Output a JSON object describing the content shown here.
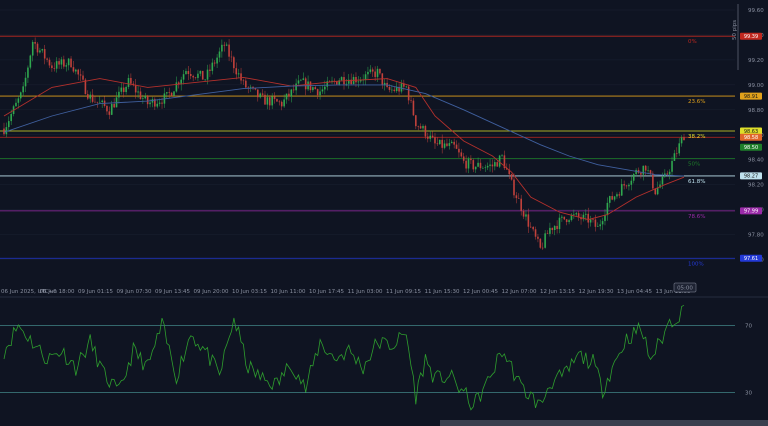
{
  "colors": {
    "background": "#0f1422",
    "grid": "#1b2132",
    "candle_up": "#2fa84f",
    "candle_down": "#c2413b",
    "ma_fast": "#b3302c",
    "ma_slow": "#3f5f9e",
    "rsi_line": "#2e9e2e",
    "rsi_band": "#4a9a9a",
    "axis_text": "#8a90a0",
    "scrollbar": "#3a3f4e"
  },
  "chart_data": [
    {
      "type": "candlestick",
      "name": "price",
      "ylim": [
        97.5,
        99.6
      ],
      "price_ticks": [
        "99.60",
        "99.40",
        "99.20",
        "99.00",
        "98.80",
        "98.60",
        "98.40",
        "98.20",
        "98.00",
        "97.80",
        "97.60"
      ],
      "time_labels": [
        "06 Jun 2025, UTC+0",
        "06 Jun 18:00",
        "09 Jun 01:15",
        "09 Jun 07:30",
        "09 Jun 13:45",
        "09 Jun 20:00",
        "10 Jun 03:15",
        "10 Jun 11:00",
        "10 Jun 17:45",
        "11 Jun 03:00",
        "11 Jun 09:15",
        "11 Jun 15:30",
        "12 Jun 00:45",
        "12 Jun 07:00",
        "12 Jun 13:15",
        "12 Jun 19:30",
        "13 Jun 04:45",
        "13 Jun 11:00"
      ],
      "crosshair_time_tag": "05:00",
      "scale_label": "50 pips",
      "key_points": [
        {
          "t": 0,
          "price": 98.65
        },
        {
          "t": 4,
          "price": 98.95
        },
        {
          "t": 6,
          "price": 99.35
        },
        {
          "t": 10,
          "price": 99.15
        },
        {
          "t": 14,
          "price": 99.18
        },
        {
          "t": 18,
          "price": 98.9
        },
        {
          "t": 22,
          "price": 98.8
        },
        {
          "t": 26,
          "price": 99.02
        },
        {
          "t": 30,
          "price": 98.85
        },
        {
          "t": 34,
          "price": 98.9
        },
        {
          "t": 38,
          "price": 99.12
        },
        {
          "t": 42,
          "price": 99.05
        },
        {
          "t": 46,
          "price": 99.32
        },
        {
          "t": 50,
          "price": 99.0
        },
        {
          "t": 54,
          "price": 98.88
        },
        {
          "t": 58,
          "price": 98.85
        },
        {
          "t": 62,
          "price": 99.02
        },
        {
          "t": 66,
          "price": 98.95
        },
        {
          "t": 70,
          "price": 99.05
        },
        {
          "t": 74,
          "price": 99.05
        },
        {
          "t": 78,
          "price": 99.1
        },
        {
          "t": 80,
          "price": 98.95
        },
        {
          "t": 84,
          "price": 98.98
        },
        {
          "t": 86,
          "price": 98.7
        },
        {
          "t": 88,
          "price": 98.62
        },
        {
          "t": 90,
          "price": 98.52
        },
        {
          "t": 94,
          "price": 98.5
        },
        {
          "t": 96,
          "price": 98.38
        },
        {
          "t": 98,
          "price": 98.35
        },
        {
          "t": 102,
          "price": 98.35
        },
        {
          "t": 104,
          "price": 98.42
        },
        {
          "t": 106,
          "price": 98.2
        },
        {
          "t": 110,
          "price": 97.85
        },
        {
          "t": 112,
          "price": 97.68
        },
        {
          "t": 114,
          "price": 97.85
        },
        {
          "t": 118,
          "price": 97.95
        },
        {
          "t": 122,
          "price": 97.92
        },
        {
          "t": 124,
          "price": 97.85
        },
        {
          "t": 126,
          "price": 98.05
        },
        {
          "t": 130,
          "price": 98.22
        },
        {
          "t": 132,
          "price": 98.3
        },
        {
          "t": 134,
          "price": 98.35
        },
        {
          "t": 136,
          "price": 98.15
        },
        {
          "t": 138,
          "price": 98.25
        },
        {
          "t": 140,
          "price": 98.42
        },
        {
          "t": 142,
          "price": 98.6
        }
      ],
      "moving_averages": [
        {
          "name": "fast",
          "points": [
            {
              "t": 0,
              "price": 98.75
            },
            {
              "t": 10,
              "price": 98.98
            },
            {
              "t": 20,
              "price": 99.05
            },
            {
              "t": 30,
              "price": 98.98
            },
            {
              "t": 40,
              "price": 99.02
            },
            {
              "t": 50,
              "price": 99.06
            },
            {
              "t": 60,
              "price": 98.99
            },
            {
              "t": 70,
              "price": 99.03
            },
            {
              "t": 80,
              "price": 99.05
            },
            {
              "t": 86,
              "price": 98.98
            },
            {
              "t": 90,
              "price": 98.75
            },
            {
              "t": 96,
              "price": 98.55
            },
            {
              "t": 102,
              "price": 98.43
            },
            {
              "t": 106,
              "price": 98.3
            },
            {
              "t": 110,
              "price": 98.1
            },
            {
              "t": 116,
              "price": 97.98
            },
            {
              "t": 122,
              "price": 97.92
            },
            {
              "t": 126,
              "price": 97.96
            },
            {
              "t": 132,
              "price": 98.1
            },
            {
              "t": 138,
              "price": 98.2
            },
            {
              "t": 142,
              "price": 98.26
            }
          ]
        },
        {
          "name": "slow",
          "points": [
            {
              "t": 0,
              "price": 98.62
            },
            {
              "t": 10,
              "price": 98.75
            },
            {
              "t": 20,
              "price": 98.85
            },
            {
              "t": 30,
              "price": 98.87
            },
            {
              "t": 40,
              "price": 98.92
            },
            {
              "t": 50,
              "price": 98.97
            },
            {
              "t": 60,
              "price": 98.99
            },
            {
              "t": 70,
              "price": 99.0
            },
            {
              "t": 80,
              "price": 99.0
            },
            {
              "t": 88,
              "price": 98.93
            },
            {
              "t": 96,
              "price": 98.8
            },
            {
              "t": 104,
              "price": 98.66
            },
            {
              "t": 112,
              "price": 98.52
            },
            {
              "t": 118,
              "price": 98.43
            },
            {
              "t": 124,
              "price": 98.36
            },
            {
              "t": 130,
              "price": 98.32
            },
            {
              "t": 136,
              "price": 98.28
            },
            {
              "t": 142,
              "price": 98.27
            }
          ]
        }
      ],
      "fibonacci_levels": [
        {
          "pct": "0%",
          "price": 99.39,
          "color": "#c0281f"
        },
        {
          "pct": "23.6%",
          "price": 98.91,
          "color": "#e0a11b"
        },
        {
          "pct": "38.2%",
          "price": 98.63,
          "color": "#dede2a"
        },
        {
          "pct": "50%",
          "price": 98.41,
          "color": "#1e7f2a"
        },
        {
          "pct": "61.8%",
          "price": 98.27,
          "color": "#bfe2ee"
        },
        {
          "pct": "78.6%",
          "price": 97.99,
          "color": "#9a2aa8"
        },
        {
          "pct": "100%",
          "price": 97.61,
          "color": "#2339d6"
        }
      ],
      "price_tags": [
        {
          "label": "99.39",
          "bg": "#c0281f",
          "fg": "#ffffff"
        },
        {
          "label": "98.91",
          "bg": "#e0a11b",
          "fg": "#1a1a1a"
        },
        {
          "label": "98.63",
          "bg": "#dede2a",
          "fg": "#1a1a1a"
        },
        {
          "label": "98.58",
          "bg": "#e0652a",
          "fg": "#ffffff"
        },
        {
          "label": "98.50",
          "bg": "#1e7f2a",
          "fg": "#ffffff"
        },
        {
          "label": "98.27",
          "bg": "#bfe2ee",
          "fg": "#1a1a1a"
        },
        {
          "label": "97.99",
          "bg": "#9a2aa8",
          "fg": "#ffffff"
        },
        {
          "label": "97.61",
          "bg": "#2339d6",
          "fg": "#ffffff"
        }
      ],
      "extra_level": {
        "price": 98.58,
        "color": "#c0281f"
      }
    },
    {
      "type": "line",
      "name": "oscillator",
      "ylim": [
        15,
        85
      ],
      "bands": [
        70,
        30
      ],
      "band_labels": [
        "70",
        "30"
      ],
      "points": [
        {
          "t": 0,
          "v": 55
        },
        {
          "t": 3,
          "v": 70
        },
        {
          "t": 6,
          "v": 60
        },
        {
          "t": 9,
          "v": 50
        },
        {
          "t": 12,
          "v": 55
        },
        {
          "t": 15,
          "v": 45
        },
        {
          "t": 18,
          "v": 60
        },
        {
          "t": 21,
          "v": 40
        },
        {
          "t": 24,
          "v": 30
        },
        {
          "t": 27,
          "v": 55
        },
        {
          "t": 30,
          "v": 45
        },
        {
          "t": 33,
          "v": 70
        },
        {
          "t": 36,
          "v": 40
        },
        {
          "t": 39,
          "v": 65
        },
        {
          "t": 42,
          "v": 55
        },
        {
          "t": 45,
          "v": 40
        },
        {
          "t": 48,
          "v": 74
        },
        {
          "t": 51,
          "v": 45
        },
        {
          "t": 54,
          "v": 38
        },
        {
          "t": 57,
          "v": 35
        },
        {
          "t": 60,
          "v": 48
        },
        {
          "t": 63,
          "v": 32
        },
        {
          "t": 66,
          "v": 60
        },
        {
          "t": 69,
          "v": 50
        },
        {
          "t": 72,
          "v": 55
        },
        {
          "t": 75,
          "v": 45
        },
        {
          "t": 78,
          "v": 60
        },
        {
          "t": 81,
          "v": 58
        },
        {
          "t": 84,
          "v": 65
        },
        {
          "t": 86,
          "v": 28
        },
        {
          "t": 88,
          "v": 50
        },
        {
          "t": 90,
          "v": 38
        },
        {
          "t": 93,
          "v": 40
        },
        {
          "t": 96,
          "v": 30
        },
        {
          "t": 98,
          "v": 22
        },
        {
          "t": 101,
          "v": 36
        },
        {
          "t": 104,
          "v": 55
        },
        {
          "t": 106,
          "v": 45
        },
        {
          "t": 108,
          "v": 33
        },
        {
          "t": 110,
          "v": 28
        },
        {
          "t": 112,
          "v": 22
        },
        {
          "t": 114,
          "v": 36
        },
        {
          "t": 117,
          "v": 40
        },
        {
          "t": 120,
          "v": 52
        },
        {
          "t": 123,
          "v": 48
        },
        {
          "t": 125,
          "v": 32
        },
        {
          "t": 127,
          "v": 45
        },
        {
          "t": 130,
          "v": 62
        },
        {
          "t": 133,
          "v": 68
        },
        {
          "t": 135,
          "v": 50
        },
        {
          "t": 137,
          "v": 60
        },
        {
          "t": 139,
          "v": 72
        },
        {
          "t": 141,
          "v": 76
        },
        {
          "t": 142,
          "v": 80
        }
      ]
    }
  ]
}
